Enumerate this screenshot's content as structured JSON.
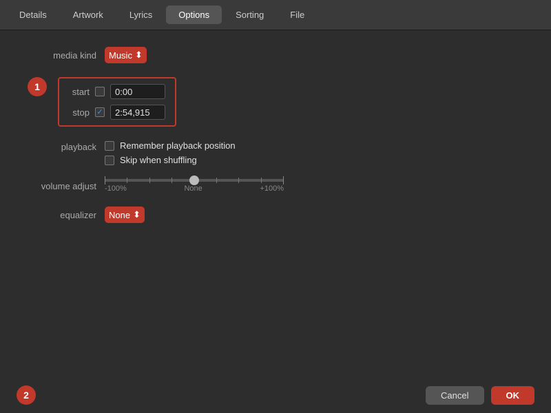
{
  "tabs": [
    {
      "id": "details",
      "label": "Details",
      "active": false
    },
    {
      "id": "artwork",
      "label": "Artwork",
      "active": false
    },
    {
      "id": "lyrics",
      "label": "Lyrics",
      "active": false
    },
    {
      "id": "options",
      "label": "Options",
      "active": true
    },
    {
      "id": "sorting",
      "label": "Sorting",
      "active": false
    },
    {
      "id": "file",
      "label": "File",
      "active": false
    }
  ],
  "form": {
    "media_kind_label": "media kind",
    "media_kind_value": "Music",
    "badge1": "1",
    "badge2": "2",
    "start_label": "start",
    "stop_label": "stop",
    "start_value": "0:00",
    "stop_value": "2:54,915",
    "start_checked": false,
    "stop_checked": true,
    "playback_label": "playback",
    "remember_label": "Remember playback position",
    "skip_label": "Skip when shuffling",
    "volume_label": "volume adjust",
    "volume_neg": "-100%",
    "volume_none": "None",
    "volume_pos": "+100%",
    "equalizer_label": "equalizer",
    "equalizer_value": "None"
  },
  "buttons": {
    "cancel": "Cancel",
    "ok": "OK"
  }
}
